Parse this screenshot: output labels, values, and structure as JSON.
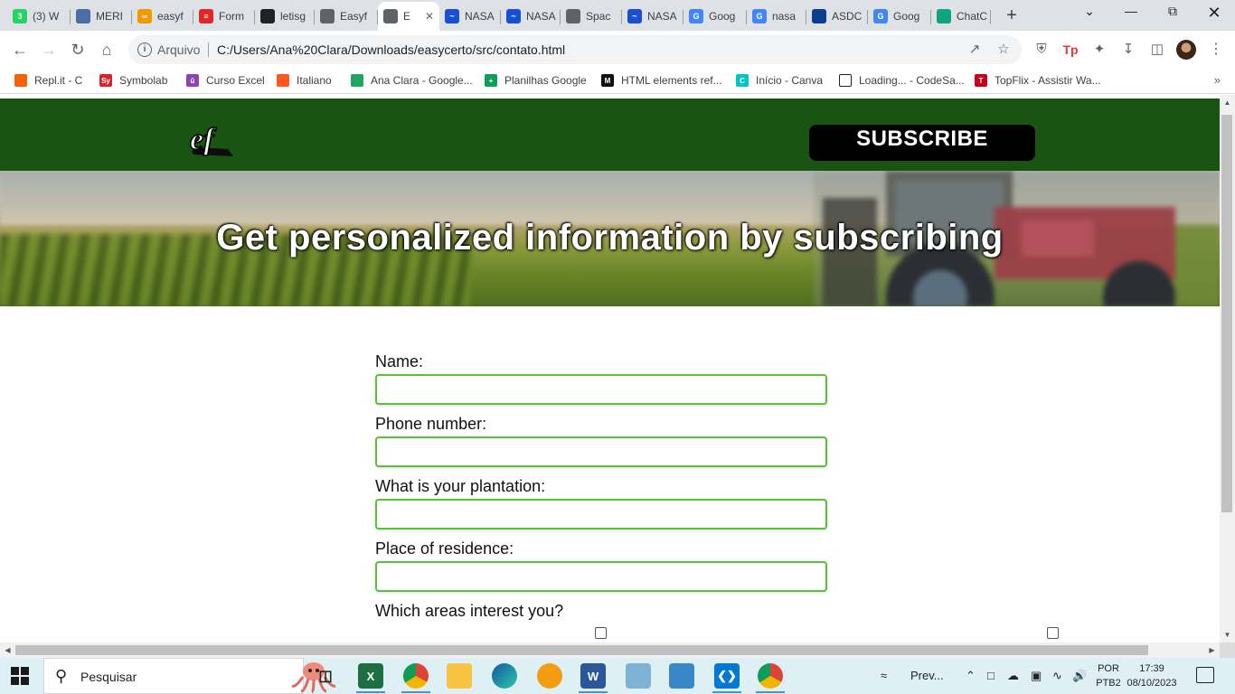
{
  "browser": {
    "tabs": [
      {
        "label": "(3) W",
        "icon": "whatsapp-icon",
        "color": "#25d366",
        "glyph": "3"
      },
      {
        "label": "MERI",
        "icon": "document-icon",
        "color": "#4a6fa5",
        "glyph": ""
      },
      {
        "label": "easyf",
        "icon": "infinity-icon",
        "color": "#f29900",
        "glyph": "∞"
      },
      {
        "label": "Form",
        "icon": "forms-icon",
        "color": "#e02727",
        "glyph": "≡"
      },
      {
        "label": "letisg",
        "icon": "github-icon",
        "color": "#202124",
        "glyph": ""
      },
      {
        "label": "Easyf",
        "icon": "page-icon",
        "color": "#5f6368",
        "glyph": ""
      },
      {
        "label": "E",
        "icon": "page-icon",
        "color": "#5f6368",
        "glyph": ""
      },
      {
        "label": "NASA",
        "icon": "nasa-icon",
        "color": "#1a4fd1",
        "glyph": "~"
      },
      {
        "label": "NASA",
        "icon": "nasa-icon",
        "color": "#1a4fd1",
        "glyph": "~"
      },
      {
        "label": "Spac",
        "icon": "globe-icon",
        "color": "#5f6368",
        "glyph": ""
      },
      {
        "label": "NASA",
        "icon": "nasa-icon",
        "color": "#1a4fd1",
        "glyph": "~"
      },
      {
        "label": "Goog",
        "icon": "translate-icon",
        "color": "#4285f4",
        "glyph": "G"
      },
      {
        "label": "nasa",
        "icon": "google-icon",
        "color": "#4285f4",
        "glyph": "G"
      },
      {
        "label": "ASDC",
        "icon": "nasa-logo-icon",
        "color": "#0b3d91",
        "glyph": ""
      },
      {
        "label": "Goog",
        "icon": "translate-icon",
        "color": "#4285f4",
        "glyph": "G"
      },
      {
        "label": "ChatC",
        "icon": "chatgpt-icon",
        "color": "#10a37f",
        "glyph": ""
      }
    ],
    "active_tab": 6,
    "omnibox": {
      "scheme_label": "Arquivo",
      "url": "C:/Users/Ana%20Clara/Downloads/easycerto/src/contato.html"
    },
    "bookmarks": [
      {
        "label": "Repl.it - C",
        "icon": "replit-icon",
        "color": "#f26207",
        "glyph": ""
      },
      {
        "label": "Symbolab",
        "icon": "symbolab-icon",
        "color": "#d8232a",
        "glyph": "Sy"
      },
      {
        "label": "Curso Excel",
        "icon": "course-icon",
        "color": "#8e44ad",
        "glyph": "û"
      },
      {
        "label": "Italiano",
        "icon": "flame-icon",
        "color": "#ff5722",
        "glyph": ""
      },
      {
        "label": "Ana Clara - Google...",
        "icon": "drive-icon",
        "color": "#1fa463",
        "glyph": ""
      },
      {
        "label": "Planilhas Google",
        "icon": "sheets-icon",
        "color": "#0f9d58",
        "glyph": "+"
      },
      {
        "label": "HTML elements ref...",
        "icon": "mdn-icon",
        "color": "#111111",
        "glyph": "M"
      },
      {
        "label": "Início - Canva",
        "icon": "canva-icon",
        "color": "#00c4cc",
        "glyph": "C"
      },
      {
        "label": "Loading... - CodeSa...",
        "icon": "blank-page-icon",
        "color": "#ffffff",
        "glyph": ""
      },
      {
        "label": "TopFlix - Assistir Wa...",
        "icon": "topflix-icon",
        "color": "#c4001a",
        "glyph": "T"
      }
    ]
  },
  "page": {
    "header": {
      "logo_text": "ef",
      "subscribe_label": "SUBSCRIBE"
    },
    "hero_title": "Get personalized information by subscribing",
    "form": {
      "fields": [
        {
          "label": "Name:",
          "value": ""
        },
        {
          "label": "Phone number:",
          "value": ""
        },
        {
          "label": "What is your plantation:",
          "value": ""
        },
        {
          "label": "Place of residence:",
          "value": ""
        }
      ],
      "interests_label": "Which areas interest you?"
    }
  },
  "taskbar": {
    "search_placeholder": "Pesquisar",
    "weather_label": "Prev...",
    "language": "POR",
    "keyboard": "PTB2",
    "time": "17:39",
    "date": "08/10/2023"
  }
}
